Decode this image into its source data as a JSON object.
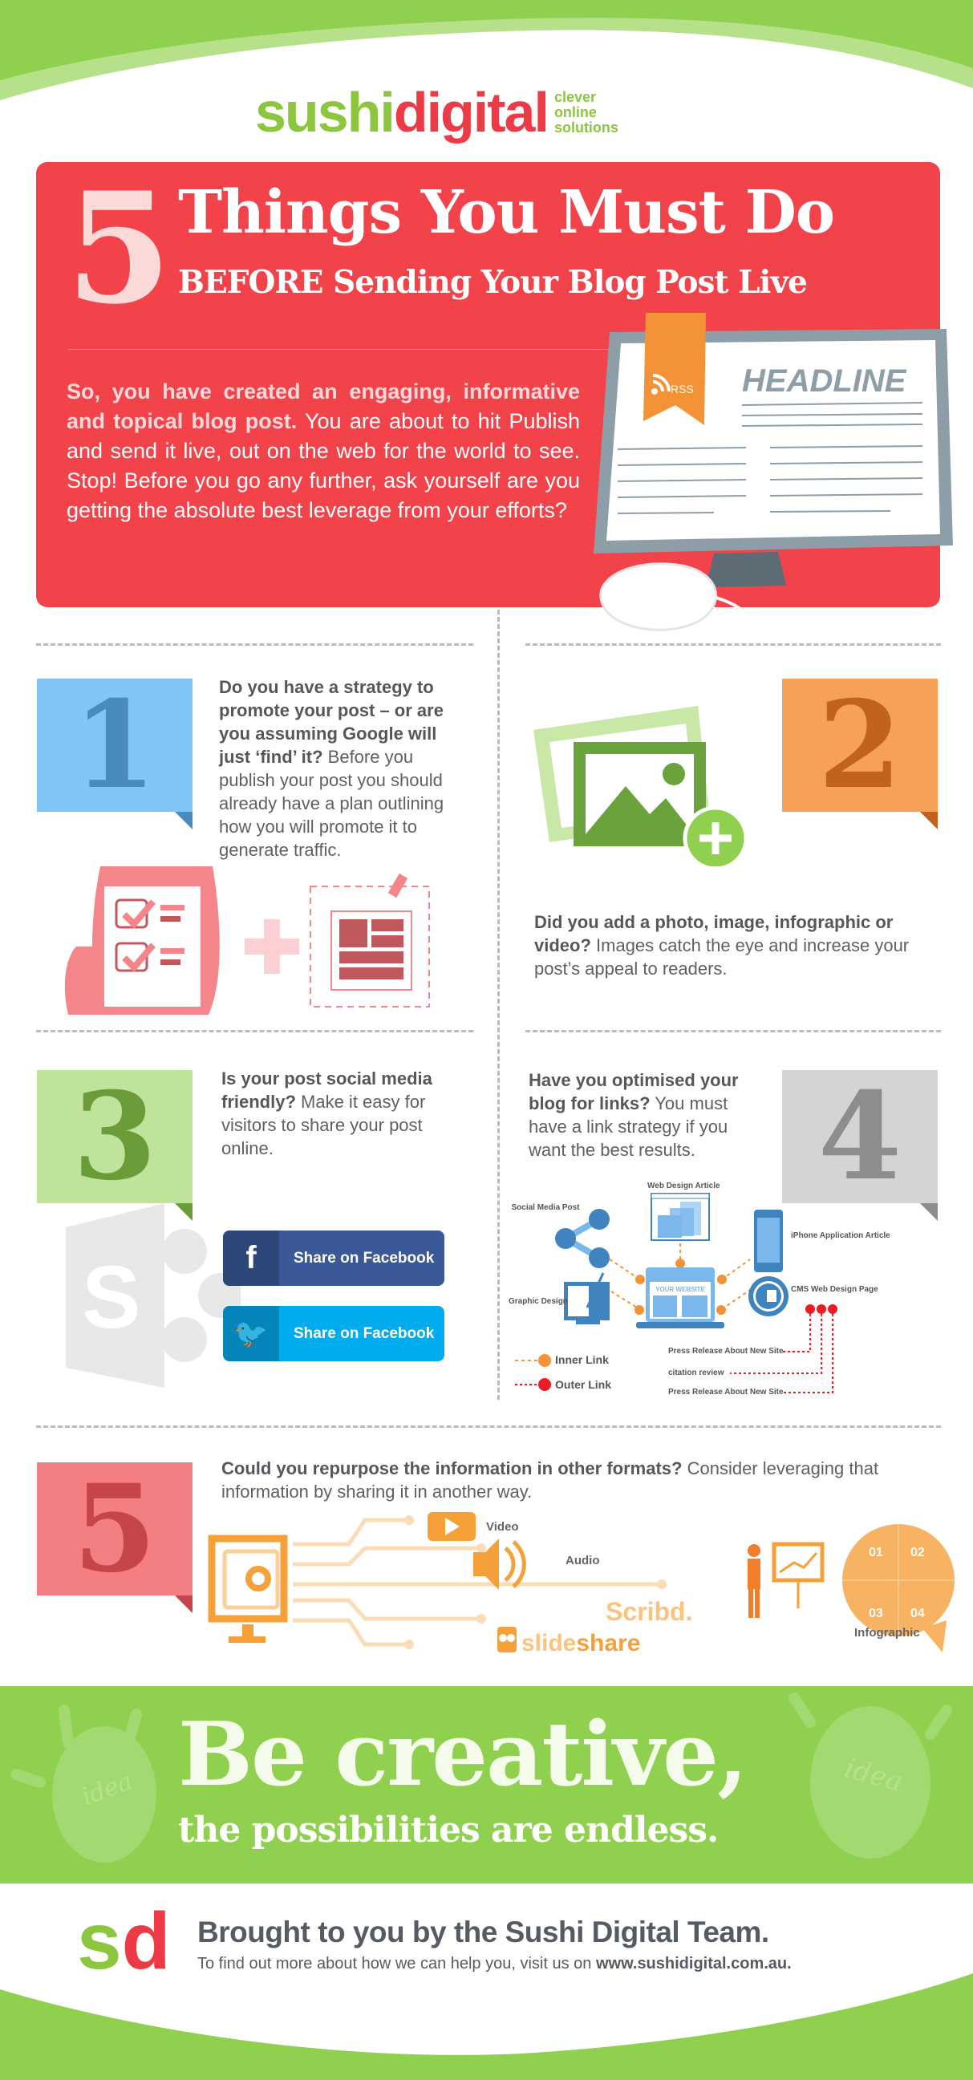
{
  "logo": {
    "sushi": "sushi",
    "digital": "digital",
    "tagline": [
      "clever",
      "online",
      "solutions"
    ]
  },
  "hero": {
    "number": "5",
    "title": "Things You Must Do",
    "subtitle": "BEFORE Sending Your Blog Post Live",
    "intro_bold": "So, you have created an engaging, informative and topical blog post.",
    "intro_rest": " You are about to hit Publish and send it live, out on the web for the world to see. Stop!  Before you go any further, ask yourself are you getting the absolute best leverage from your efforts?",
    "monitor_headline": "HEADLINE",
    "rss_label": "RSS"
  },
  "steps": [
    {
      "number": "1",
      "bold": "Do you have a strategy to promote your post – or are you assuming Google will just ‘find’ it?",
      "text": " Before you publish your post you should already have a plan outlining how you will promote it to generate traffic."
    },
    {
      "number": "2",
      "bold": "Did you add a photo, image, infographic or video?",
      "text": " Images catch the eye and increase your post’s appeal to readers."
    },
    {
      "number": "3",
      "bold": "Is your post social media friendly?",
      "text": " Make it easy for visitors to share your post online.",
      "buttons": [
        "Share on Facebook",
        "Share on Facebook"
      ]
    },
    {
      "number": "4",
      "bold": "Have you optimised your blog for links?",
      "text": " You must have a link strategy if you want the best results.",
      "diagram": {
        "center": "YOUR WEBSITE",
        "nodes": [
          "Web Design Article",
          "Social Media Post",
          "Graphic Design",
          "iPhone Application Article",
          "CMS Web Design Page"
        ],
        "outer": [
          "Press Release About New Site",
          "citation review",
          "Press Release About New Site"
        ],
        "legend": [
          "Inner Link",
          "Outer Link"
        ]
      }
    },
    {
      "number": "5",
      "bold": "Could you repurpose the information in other formats?",
      "text": " Consider leveraging that information by sharing it in another way.",
      "formats": {
        "video": "Video",
        "audio": "Audio",
        "scribd": "Scribd.",
        "slide": "slide",
        "share": "share",
        "infographic": "Infographic",
        "puzzle": [
          "01",
          "02",
          "03",
          "04"
        ]
      }
    }
  ],
  "banner": {
    "line1": "Be creative,",
    "line2": "the possibilities are endless.",
    "bulb_text": "idea"
  },
  "footer": {
    "logo_s": "s",
    "logo_d": "d",
    "title": "Brought to you by the Sushi Digital Team.",
    "text": "To find out more about how we can help you, visit us on ",
    "url": "www.sushidigital.com.au."
  },
  "colors": {
    "green": "#8fd14f",
    "red": "#f2434a",
    "blue": "#80c5f8",
    "orange": "#f6a05a",
    "lightgreen": "#bfe39a",
    "grey": "#d4d4d2",
    "pink": "#f47f82"
  }
}
